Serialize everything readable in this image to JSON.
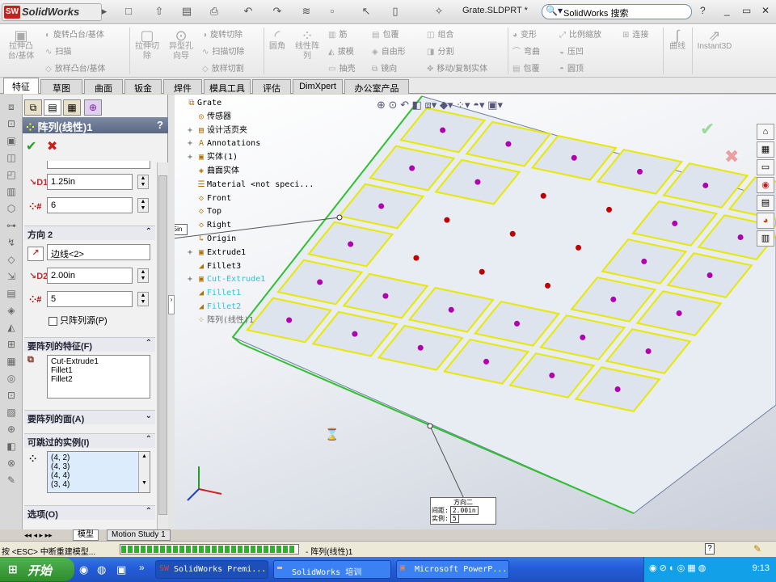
{
  "app": {
    "logo_text": "SolidWorks",
    "document_title": "Grate.SLDPRT *",
    "search_text": "SolidWorks 搜索",
    "help": "?"
  },
  "ribbon": {
    "extrude_boss": "拉伸凸\n台/基体",
    "revolve_boss": "旋转凸台/基体",
    "sweep": "扫描",
    "loft_boss": "放样凸台/基体",
    "extrude_cut": "拉伸切\n除",
    "hole_wizard": "异型孔\n向导",
    "revolve_cut": "旋转切除",
    "sweep_cut": "扫描切除",
    "loft_cut": "放样切割",
    "fillet": "圆角",
    "linear_pattern": "线性阵\n列",
    "rib": "筋",
    "draft": "拔模",
    "shell": "抽壳",
    "wrap": "包覆",
    "dome": "自由形",
    "mirror": "镜向",
    "combine": "组合",
    "split": "分割",
    "move_copy": "移动/复制实体",
    "deform": "变形",
    "flex": "弯曲",
    "wrap2": "包覆",
    "scale": "比例缩放",
    "indent": "压凹",
    "dome2": "圆顶",
    "connect": "连接",
    "curves": "曲线",
    "instant3d": "Instant3D"
  },
  "tabs": [
    "特征",
    "草图",
    "曲面",
    "钣金",
    "焊件",
    "模具工具",
    "评估",
    "DimXpert",
    "办公室产品"
  ],
  "property_manager": {
    "title": "阵列(线性)1",
    "help": "?",
    "direction1": {
      "spacing": "1.25in",
      "instances": "6"
    },
    "direction2": {
      "header": "方向 2",
      "edge": "边线<2>",
      "spacing": "2.00in",
      "instances": "5",
      "seed_only_label": "只阵列源(P)"
    },
    "features_header": "要阵列的特征(F)",
    "features": [
      "Cut-Extrude1",
      "Fillet1",
      "Fillet2"
    ],
    "faces_header": "要阵列的面(A)",
    "skip_header": "可跳过的实例(I)",
    "skip_instances": [
      "(4, 2)",
      "(4, 3)",
      "(4, 4)",
      "(3, 4)"
    ],
    "options_header": "选项(O)"
  },
  "feature_tree": [
    {
      "label": "Grate",
      "style": "normal"
    },
    {
      "label": "传感器",
      "style": "normal"
    },
    {
      "label": "设计活页夹",
      "style": "normal"
    },
    {
      "label": "Annotations",
      "style": "normal"
    },
    {
      "label": "实体(1)",
      "style": "normal"
    },
    {
      "label": "曲面实体",
      "style": "normal"
    },
    {
      "label": "Material <not speci...",
      "style": "normal"
    },
    {
      "label": "Front",
      "style": "normal"
    },
    {
      "label": "Top",
      "style": "normal"
    },
    {
      "label": "Right",
      "style": "normal"
    },
    {
      "label": "Origin",
      "style": "normal"
    },
    {
      "label": "Extrude1",
      "style": "normal"
    },
    {
      "label": "Fillet3",
      "style": "normal"
    },
    {
      "label": "Cut-Extrude1",
      "style": "cyan"
    },
    {
      "label": "Fillet1",
      "style": "cyan"
    },
    {
      "label": "Fillet2",
      "style": "cyan"
    },
    {
      "label": "阵列(线性)1",
      "style": "grey"
    }
  ],
  "callouts": {
    "dir1_value": "5in",
    "dir2_title": "方向二",
    "dir2_spacing_label": "间距:",
    "dir2_spacing": "2.00in",
    "dir2_instances_label": "实例:",
    "dir2_instances": "5"
  },
  "bottom_tabs": [
    "模型",
    "Motion Study 1"
  ],
  "status": {
    "text": "按 <ESC> 中断重建模型...",
    "progress_label": "- 阵列(线性)1",
    "progress": 0.98
  },
  "taskbar": {
    "start": "开始",
    "buttons": [
      "SolidWorks Premi...",
      "SolidWorks 培训",
      "Microsoft PowerP..."
    ],
    "clock": "9:13"
  },
  "colors": {
    "sketch_yellow": "#e8e800",
    "seed_point": "#b000b0",
    "skip_point": "#c00000",
    "edge_green": "#20c020"
  }
}
